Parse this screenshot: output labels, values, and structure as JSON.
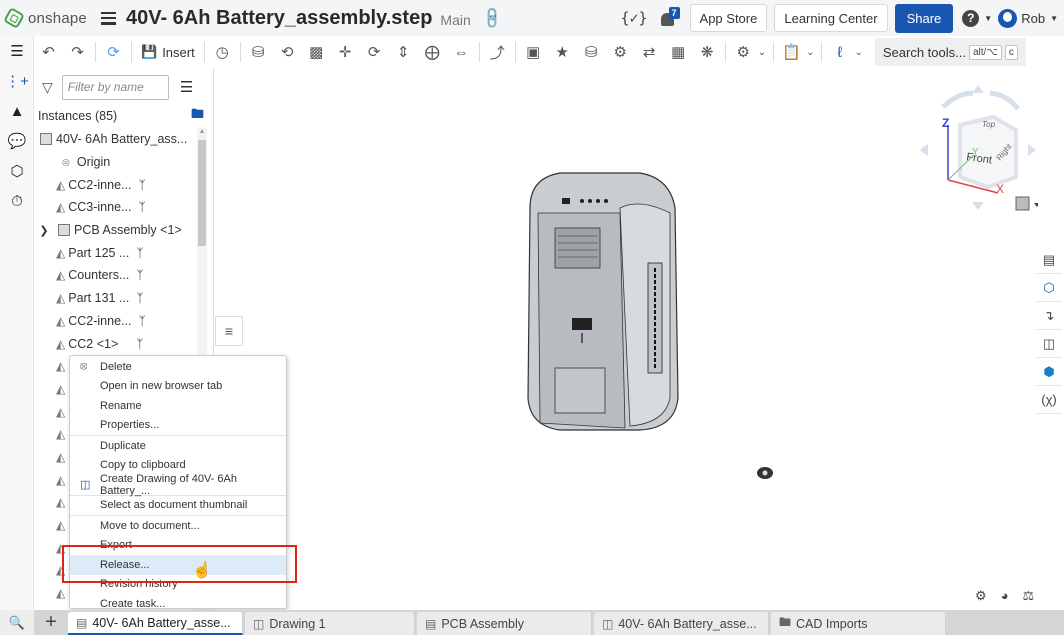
{
  "app": {
    "brand": "onshape",
    "doc_title": "40V- 6Ah Battery_assembly.step",
    "branch": "Main"
  },
  "topbar": {
    "notifications_count": "7",
    "app_store": "App Store",
    "learning_center": "Learning Center",
    "share": "Share",
    "help": "?",
    "user": "Rob"
  },
  "toolbar": {
    "insert": "Insert",
    "search_tools": "Search tools...",
    "shortcut_1": "alt/⌥",
    "shortcut_2": "c"
  },
  "panel": {
    "filter_placeholder": "Filter by name",
    "instances_label": "Instances (85)",
    "tree": [
      {
        "label": "40V- 6Ah Battery_ass...",
        "type": "assembly",
        "indent": 0
      },
      {
        "label": "Origin",
        "type": "origin",
        "indent": 1
      },
      {
        "label": "CC2-inne...",
        "type": "part",
        "indent": 1,
        "mate": true
      },
      {
        "label": "CC3-inne...",
        "type": "part",
        "indent": 1,
        "mate": true
      },
      {
        "label": "PCB Assembly <1>",
        "type": "subassembly",
        "indent": 1,
        "expandable": true
      },
      {
        "label": "Part 125 ...",
        "type": "part",
        "indent": 1,
        "mate": true
      },
      {
        "label": "Counters...",
        "type": "part",
        "indent": 1,
        "mate": true
      },
      {
        "label": "Part 131 ...",
        "type": "part",
        "indent": 1,
        "mate": true
      },
      {
        "label": "CC2-inne...",
        "type": "part",
        "indent": 1,
        "mate": true
      },
      {
        "label": "CC2 <1>",
        "type": "part",
        "indent": 1,
        "mate": true
      }
    ]
  },
  "context_menu": {
    "groups": [
      [
        {
          "label": "Delete",
          "icon": "delete-icon"
        },
        {
          "label": "Open in new browser tab"
        },
        {
          "label": "Rename"
        },
        {
          "label": "Properties..."
        }
      ],
      [
        {
          "label": "Duplicate"
        },
        {
          "label": "Copy to clipboard"
        },
        {
          "label": "Create Drawing of 40V- 6Ah Battery_...",
          "icon": "create-drawing-icon"
        }
      ],
      [
        {
          "label": "Select as document thumbnail"
        }
      ],
      [
        {
          "label": "Move to document..."
        },
        {
          "label": "Export"
        },
        {
          "label": "Release...",
          "highlighted": true
        },
        {
          "label": "Revision history"
        },
        {
          "label": "Create task..."
        }
      ]
    ]
  },
  "viewcube": {
    "top": "Top",
    "front": "Front",
    "right": "Right",
    "x": "X",
    "y": "Y",
    "z": "Z"
  },
  "tabs": [
    {
      "label": "40V- 6Ah Battery_asse...",
      "icon": "assembly-icon",
      "active": true
    },
    {
      "label": "Drawing 1",
      "icon": "drawing-icon"
    },
    {
      "label": "PCB Assembly",
      "icon": "assembly-icon"
    },
    {
      "label": "40V- 6Ah Battery_asse...",
      "icon": "part-studio-icon"
    },
    {
      "label": "CAD Imports",
      "icon": "folder-icon"
    }
  ]
}
